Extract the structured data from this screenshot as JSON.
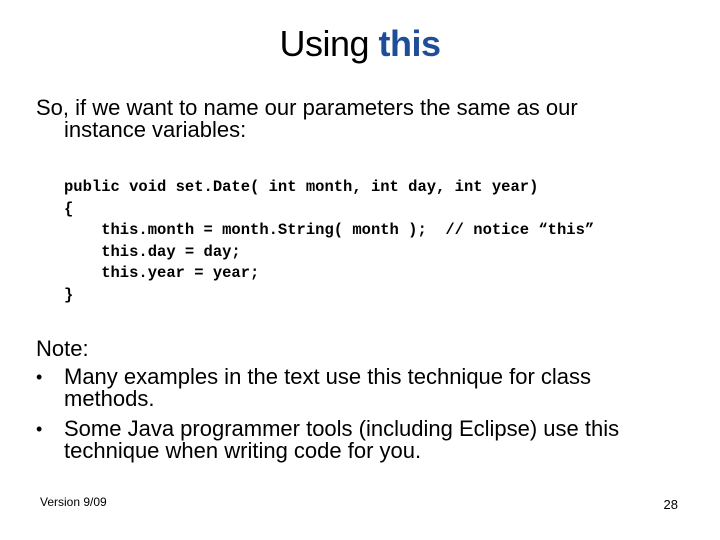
{
  "slide": {
    "title": {
      "prefix": "Using ",
      "keyword": "this",
      "keyword_color": "#1f4e99"
    },
    "intro": {
      "line1": "So, if we want to name our parameters the same as our",
      "line2": "instance variables:"
    },
    "code": {
      "lines": [
        "public void set.Date( int month, int day, int year)",
        "{",
        "    this.month = month.String( month );  // notice “this”",
        "    this.day = day;",
        "    this.year = year;",
        "}"
      ]
    },
    "note": {
      "label": "Note:",
      "bullets": [
        {
          "line1": "Many examples in the text use this technique for class",
          "line2": "methods."
        },
        {
          "line1": "Some Java programmer tools (including Eclipse) use this",
          "line2": "technique when writing code for you."
        }
      ],
      "bullet_glyph": "•"
    },
    "footer": {
      "version": "Version 9/09",
      "page_number": "28"
    }
  }
}
